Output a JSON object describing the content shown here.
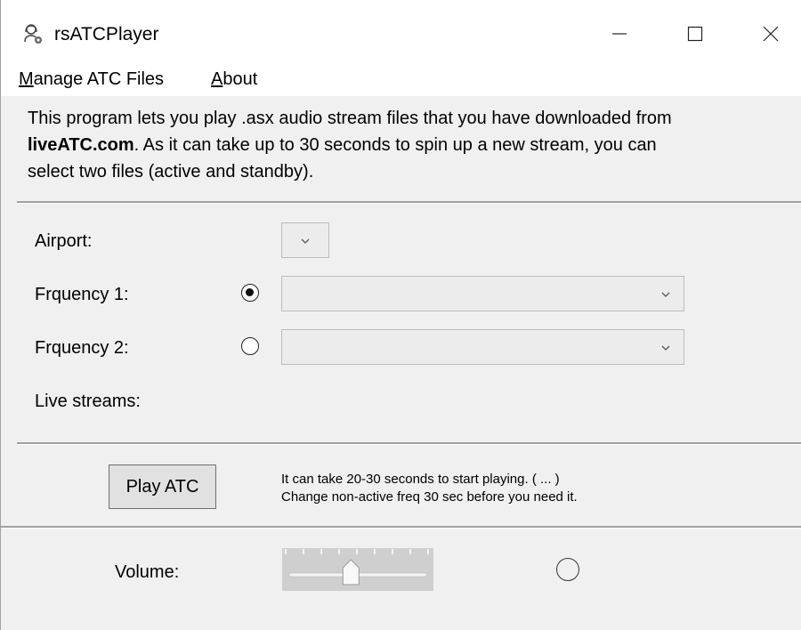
{
  "window": {
    "title": "rsATCPlayer",
    "app_icon": "headset-icon",
    "controls": [
      "minimize-icon",
      "maximize-icon",
      "close-icon"
    ]
  },
  "menu": {
    "manage_mnemonic": "M",
    "manage_rest": "anage ATC Files",
    "about_mnemonic": "A",
    "about_rest": "bout"
  },
  "intro": {
    "line1": "This program lets you play .asx audio stream files that you have downloaded from",
    "link_text": "liveATC.com",
    "line2_rest": ". As it can take up to 30 seconds to spin up a new stream, you can",
    "line3": "select two files (active and standby)."
  },
  "form": {
    "airport_label": "Airport:",
    "airport_value": "",
    "freq1_label": "Frquency 1:",
    "freq1_value": "",
    "freq1_selected": true,
    "freq2_label": "Frquency 2:",
    "freq2_value": "",
    "freq2_selected": false,
    "live_streams_label": "Live streams:"
  },
  "play": {
    "button_label": "Play ATC",
    "help_line1": "It can take 20-30 seconds to start playing. ( ... )",
    "help_line2": "Change non-active freq 30 sec before you need it."
  },
  "volume": {
    "label": "Volume:",
    "level_fraction": 0.45
  },
  "colors": {
    "window_bg": "#f0f0f0",
    "slider_bg": "#cfcfcf"
  }
}
